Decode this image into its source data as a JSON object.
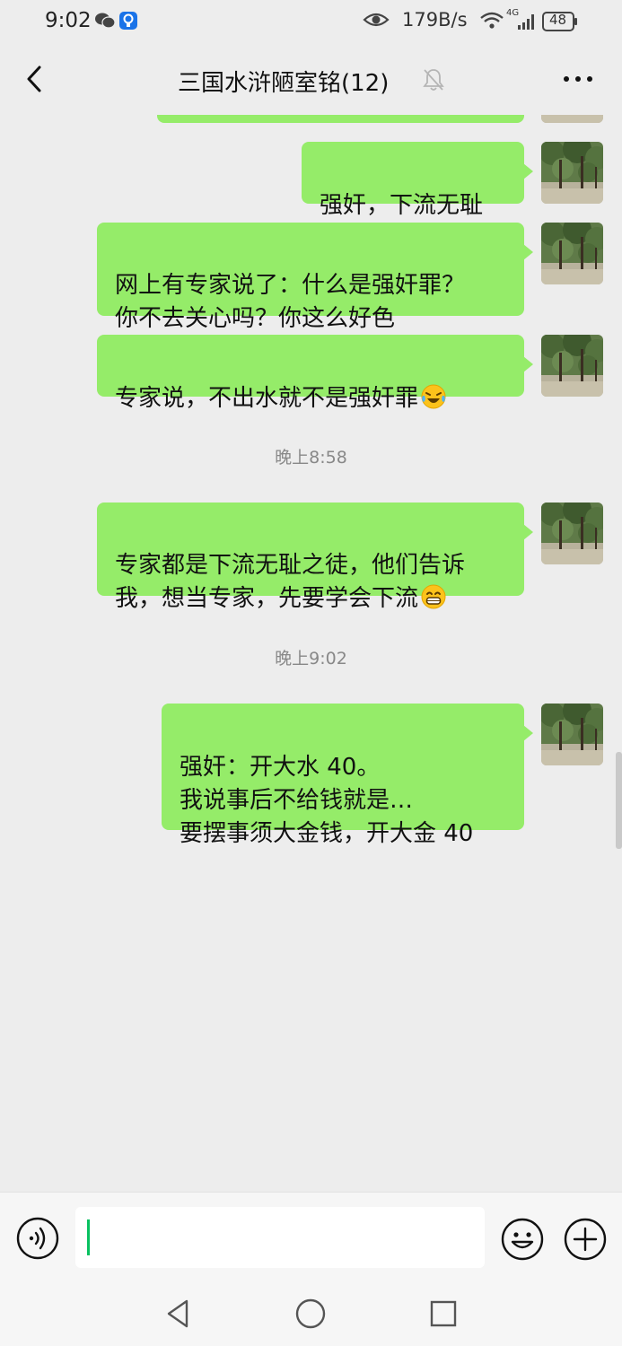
{
  "status_bar": {
    "time": "9:02",
    "net_speed": "179B/s",
    "signal_label": "4G",
    "battery": "48"
  },
  "header": {
    "title": "三国水浒陋室铭(12)",
    "back_icon": "chevron-left-icon",
    "mute_icon": "bell-off-icon",
    "more_icon": "more-dots-icon"
  },
  "messages": [
    {
      "text": "强奸，下流无耻"
    },
    {
      "text": "网上有专家说了：什么是强奸罪？\n你不去关心吗？你这么好色"
    },
    {
      "text": "专家说，不出水就不是强奸罪",
      "emoji": "laughing-crying-emoji"
    },
    {
      "text": "专家都是下流无耻之徒，他们告诉\n我，想当专家，先要学会下流",
      "emoji": "grinning-emoji"
    },
    {
      "text": "强奸：开大水 40。\n我说事后不给钱就是…\n要摆事须大金钱，开大金 40"
    }
  ],
  "timestamps": [
    "晚上8:58",
    "晚上9:02"
  ],
  "input": {
    "value": "",
    "placeholder": ""
  },
  "colors": {
    "bubble": "#95ec69",
    "background": "#ededed",
    "accent": "#07c160"
  }
}
